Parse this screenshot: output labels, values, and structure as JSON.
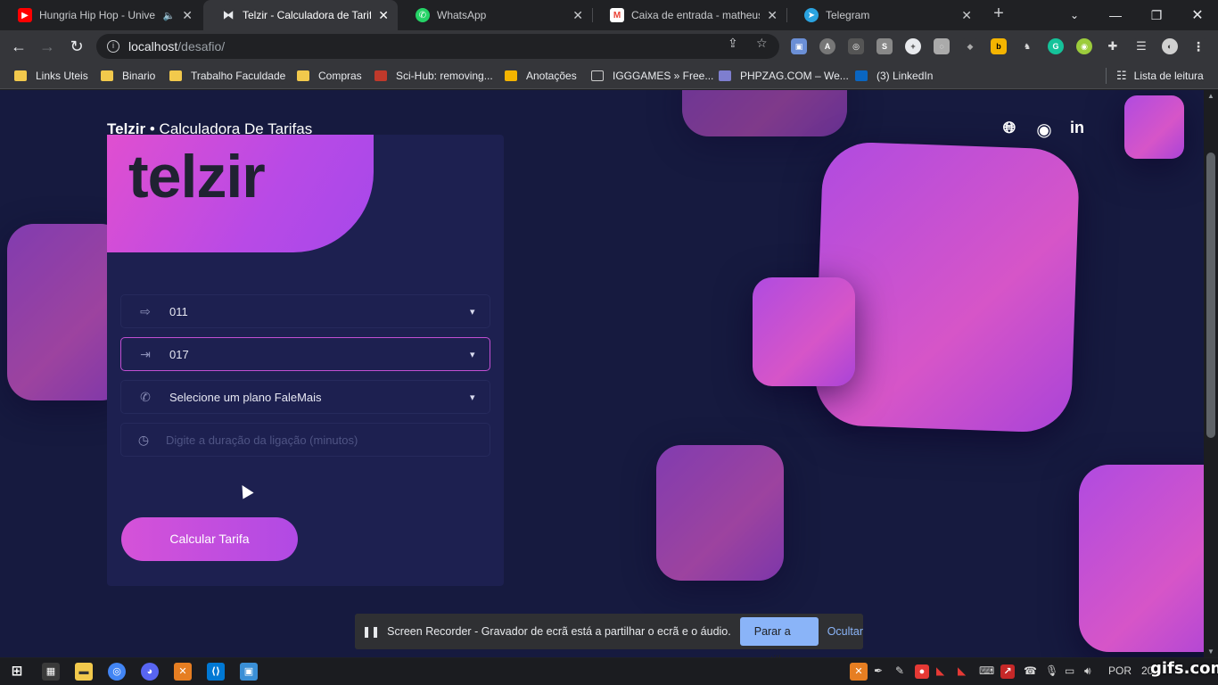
{
  "browser": {
    "tabs": [
      {
        "title": "Hungria Hip Hop - Unive",
        "favicon": "youtube-icon",
        "color": "#ff0000",
        "audio": "🔈"
      },
      {
        "title": "Telzir - Calculadora de Tarifas",
        "favicon": "telzir-icon",
        "color": "#444",
        "active": true
      },
      {
        "title": "WhatsApp",
        "favicon": "whatsapp-icon",
        "color": "#25d366"
      },
      {
        "title": "Caixa de entrada - matheuss",
        "favicon": "gmail-icon",
        "color": "#ea4335"
      },
      {
        "title": "Telegram",
        "favicon": "telegram-icon",
        "color": "#2aa3e0"
      }
    ],
    "address": {
      "host": "localhost",
      "path": "/desafio/"
    },
    "bookmarks": [
      {
        "label": "Links Uteis",
        "type": "folder"
      },
      {
        "label": "Binario",
        "type": "folder"
      },
      {
        "label": "Trabalho Faculdade",
        "type": "folder"
      },
      {
        "label": "Compras",
        "type": "folder"
      },
      {
        "label": "Sci-Hub: removing...",
        "type": "site"
      },
      {
        "label": "Anotações",
        "type": "site"
      },
      {
        "label": "IGGGAMES » Free...",
        "type": "site"
      },
      {
        "label": "PHPZAG.COM – We...",
        "type": "site"
      },
      {
        "label": "(3) LinkedIn",
        "type": "site"
      }
    ],
    "reading_list": "Lista de leitura"
  },
  "page": {
    "brand_bold": "Telzir",
    "brand_rest": " • Calculadora De Tarifas",
    "logo_text": "telzir",
    "fields": {
      "origin": {
        "value": "011",
        "icon": "sign-out-icon"
      },
      "destination": {
        "value": "017",
        "icon": "sign-in-icon"
      },
      "plan": {
        "value": "Selecione um plano FaleMais",
        "icon": "phone-icon"
      },
      "duration": {
        "placeholder": "Digite a duração da ligação (minutos)",
        "icon": "clock-icon"
      }
    },
    "calculate_label": "Calcular Tarifa",
    "accent": "#c14fd2"
  },
  "sharebar": {
    "text": "Screen Recorder - Gravador de ecrã está a partilhar o ecrã e o áudio.",
    "stop_label": "Parar a partilha",
    "hide_label": "Ocultar"
  },
  "taskbar": {
    "language": "POR",
    "clock": "20"
  },
  "watermark": "gifs.com"
}
